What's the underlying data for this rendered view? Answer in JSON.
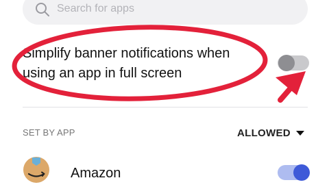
{
  "search": {
    "placeholder": "Search for apps"
  },
  "setting": {
    "label": "Simplify banner notifications when using an app in full screen",
    "enabled": false
  },
  "section": {
    "label": "SET BY APP",
    "filter_value": "ALLOWED"
  },
  "apps": [
    {
      "name": "Amazon",
      "enabled": true,
      "icon": "amazon-app-icon"
    }
  ],
  "colors": {
    "annotation_red": "#e3213a",
    "toggle_on_track": "#aebcf0",
    "toggle_on_knob": "#3e5ad8",
    "toggle_off_track": "#c9c9cc",
    "toggle_off_knob": "#8e8e92"
  }
}
